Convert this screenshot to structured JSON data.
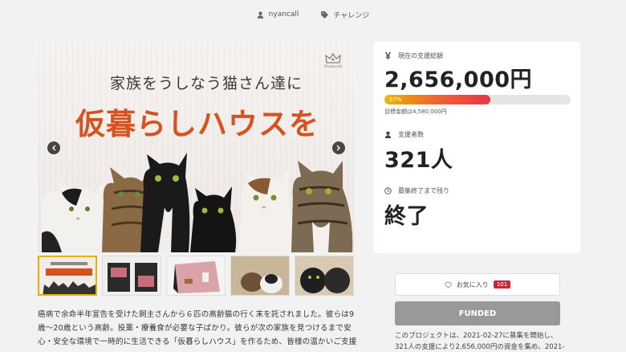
{
  "meta": {
    "author": "nyancall",
    "category": "チャレンジ"
  },
  "hero": {
    "brand": "Nyancall",
    "subtitle": "家族をうしなう猫さん達に",
    "title": "仮暮らしハウスを"
  },
  "stats": {
    "funded_label": "現在の支援総額",
    "funded_amount": "2,656,000円",
    "progress_label": "57%",
    "progress_fraction": 0.57,
    "goal_text": "目標金額は4,580,000円",
    "supporters_label": "支援者数",
    "supporters_value": "321人",
    "remaining_label": "募集終了まで残り",
    "remaining_value": "終了"
  },
  "actions": {
    "favorite_label": "お気に入り",
    "favorite_count": "101",
    "funded_label": "FUNDED"
  },
  "project_note": "このプロジェクトは、2021-02-27に募集を開始し、321人の支援により2,656,000円の資金を集め、2021-",
  "description": "癌病で余命半年宣告を受けた飼主さんから６匹の高齢猫の行く末を託されました。彼らは9歳〜20歳という高齢。投薬・療養食が必要な子ばかり。彼らが次の家族を見つけるまで安心・安全な環境で一時的に生活できる「仮暮らしハウス」を作るため、皆様の温かいご支援",
  "colors": {
    "accent_title": "#d4531f",
    "progress_start": "#f0b400",
    "progress_end": "#e8354a",
    "badge": "#c8283a",
    "funded_button": "#999999"
  }
}
